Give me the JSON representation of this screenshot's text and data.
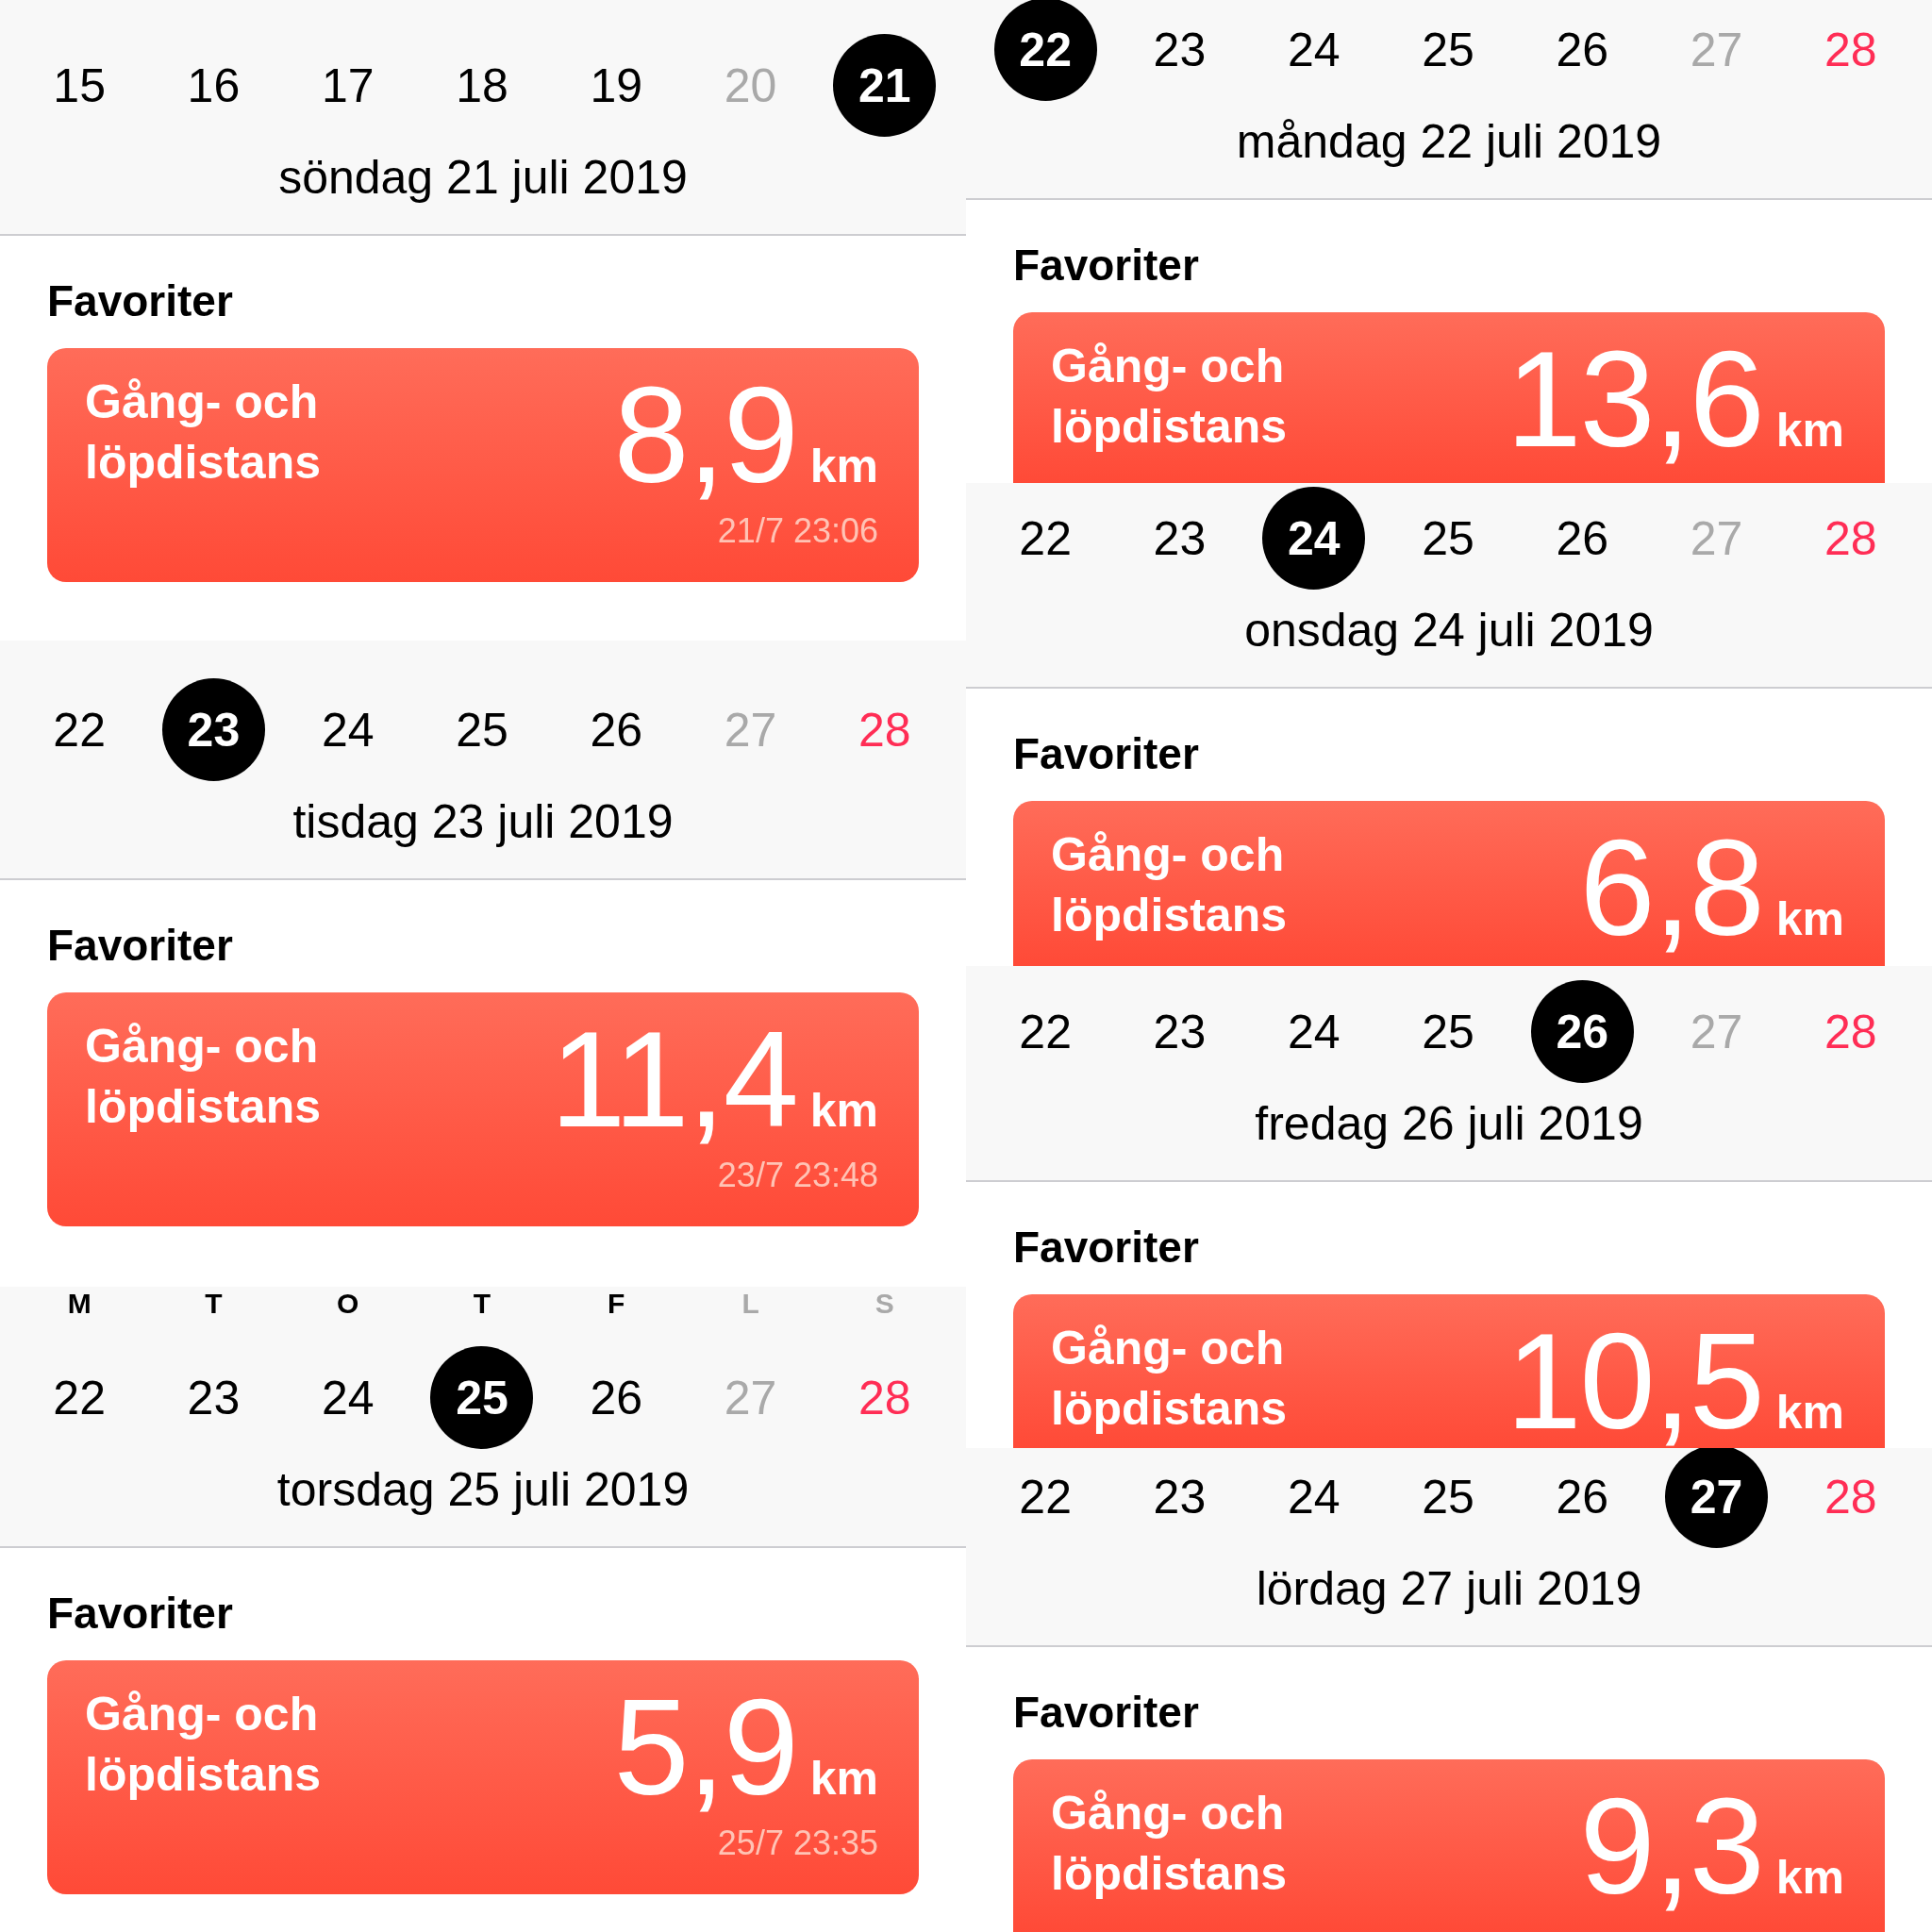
{
  "columns": [
    {
      "panels": [
        {
          "days": [
            {
              "label": "15",
              "kind": "weekday",
              "selected": false
            },
            {
              "label": "16",
              "kind": "weekday",
              "selected": false
            },
            {
              "label": "17",
              "kind": "weekday",
              "selected": false
            },
            {
              "label": "18",
              "kind": "weekday",
              "selected": false
            },
            {
              "label": "19",
              "kind": "weekday",
              "selected": false
            },
            {
              "label": "20",
              "kind": "saturday",
              "selected": false
            },
            {
              "label": "21",
              "kind": "sunday",
              "selected": true
            }
          ],
          "date": "söndag 21 juli 2019",
          "section_title": "Favoriter",
          "card": {
            "title": "Gång- och löpdistans",
            "value": "8,9",
            "unit": "km",
            "timestamp": "21/7 23:06"
          }
        },
        {
          "days": [
            {
              "label": "22",
              "kind": "weekday",
              "selected": false
            },
            {
              "label": "23",
              "kind": "weekday",
              "selected": true
            },
            {
              "label": "24",
              "kind": "weekday",
              "selected": false
            },
            {
              "label": "25",
              "kind": "weekday",
              "selected": false
            },
            {
              "label": "26",
              "kind": "weekday",
              "selected": false
            },
            {
              "label": "27",
              "kind": "saturday",
              "selected": false
            },
            {
              "label": "28",
              "kind": "sunday",
              "selected": false
            }
          ],
          "date": "tisdag 23 juli 2019",
          "section_title": "Favoriter",
          "card": {
            "title": "Gång- och löpdistans",
            "value": "11,4",
            "unit": "km",
            "timestamp": "23/7 23:48"
          }
        },
        {
          "weekdays": [
            {
              "label": "M",
              "kind": "weekday"
            },
            {
              "label": "T",
              "kind": "weekday"
            },
            {
              "label": "O",
              "kind": "weekday"
            },
            {
              "label": "T",
              "kind": "weekday"
            },
            {
              "label": "F",
              "kind": "weekday"
            },
            {
              "label": "L",
              "kind": "saturday"
            },
            {
              "label": "S",
              "kind": "sunday"
            }
          ],
          "days": [
            {
              "label": "22",
              "kind": "weekday",
              "selected": false
            },
            {
              "label": "23",
              "kind": "weekday",
              "selected": false
            },
            {
              "label": "24",
              "kind": "weekday",
              "selected": false
            },
            {
              "label": "25",
              "kind": "weekday",
              "selected": true
            },
            {
              "label": "26",
              "kind": "weekday",
              "selected": false
            },
            {
              "label": "27",
              "kind": "saturday",
              "selected": false
            },
            {
              "label": "28",
              "kind": "sunday",
              "selected": false
            }
          ],
          "date": "torsdag 25 juli 2019",
          "section_title": "Favoriter",
          "card": {
            "title": "Gång- och löpdistans",
            "value": "5,9",
            "unit": "km",
            "timestamp": "25/7 23:35"
          }
        }
      ]
    },
    {
      "panels": [
        {
          "days": [
            {
              "label": "22",
              "kind": "weekday",
              "selected": true
            },
            {
              "label": "23",
              "kind": "weekday",
              "selected": false
            },
            {
              "label": "24",
              "kind": "weekday",
              "selected": false
            },
            {
              "label": "25",
              "kind": "weekday",
              "selected": false
            },
            {
              "label": "26",
              "kind": "weekday",
              "selected": false
            },
            {
              "label": "27",
              "kind": "saturday",
              "selected": false
            },
            {
              "label": "28",
              "kind": "sunday",
              "selected": false
            }
          ],
          "date": "måndag 22 juli 2019",
          "section_title": "Favoriter",
          "card": {
            "title": "Gång- och löpdistans",
            "value": "13,6",
            "unit": "km"
          }
        },
        {
          "days": [
            {
              "label": "22",
              "kind": "weekday",
              "selected": false
            },
            {
              "label": "23",
              "kind": "weekday",
              "selected": false
            },
            {
              "label": "24",
              "kind": "weekday",
              "selected": true
            },
            {
              "label": "25",
              "kind": "weekday",
              "selected": false
            },
            {
              "label": "26",
              "kind": "weekday",
              "selected": false
            },
            {
              "label": "27",
              "kind": "saturday",
              "selected": false
            },
            {
              "label": "28",
              "kind": "sunday",
              "selected": false
            }
          ],
          "date": "onsdag 24 juli 2019",
          "section_title": "Favoriter",
          "card": {
            "title": "Gång- och löpdistans",
            "value": "6,8",
            "unit": "km"
          }
        },
        {
          "days": [
            {
              "label": "22",
              "kind": "weekday",
              "selected": false
            },
            {
              "label": "23",
              "kind": "weekday",
              "selected": false
            },
            {
              "label": "24",
              "kind": "weekday",
              "selected": false
            },
            {
              "label": "25",
              "kind": "weekday",
              "selected": false
            },
            {
              "label": "26",
              "kind": "weekday",
              "selected": true
            },
            {
              "label": "27",
              "kind": "saturday",
              "selected": false
            },
            {
              "label": "28",
              "kind": "sunday",
              "selected": false
            }
          ],
          "date": "fredag 26 juli 2019",
          "section_title": "Favoriter",
          "card": {
            "title": "Gång- och löpdistans",
            "value": "10,5",
            "unit": "km"
          }
        },
        {
          "days": [
            {
              "label": "22",
              "kind": "weekday",
              "selected": false
            },
            {
              "label": "23",
              "kind": "weekday",
              "selected": false
            },
            {
              "label": "24",
              "kind": "weekday",
              "selected": false
            },
            {
              "label": "25",
              "kind": "weekday",
              "selected": false
            },
            {
              "label": "26",
              "kind": "weekday",
              "selected": false
            },
            {
              "label": "27",
              "kind": "saturday",
              "selected": true
            },
            {
              "label": "28",
              "kind": "sunday",
              "selected": false
            }
          ],
          "date": "lördag 27 juli 2019",
          "section_title": "Favoriter",
          "card": {
            "title": "Gång- och löpdistans",
            "value": "9,3",
            "unit": "km"
          }
        }
      ]
    }
  ]
}
